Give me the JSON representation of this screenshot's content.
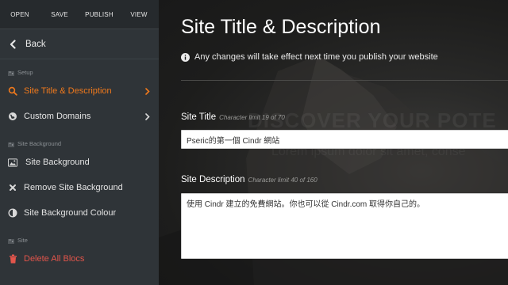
{
  "toolbar": {
    "open": "OPEN",
    "save": "SAVE",
    "publish": "PUBLISH",
    "view": "VIEW"
  },
  "sidebar": {
    "back_label": "Back",
    "sections": [
      {
        "title": "Setup",
        "items": [
          {
            "label": "Site Title & Description",
            "icon": "search-icon",
            "active": true
          },
          {
            "label": "Custom Domains",
            "icon": "globe-icon"
          }
        ]
      },
      {
        "title": "Site Background",
        "items": [
          {
            "label": "Site Background",
            "icon": "image-icon"
          },
          {
            "label": "Remove Site Background",
            "icon": "close-icon"
          },
          {
            "label": "Site Background Colour",
            "icon": "contrast-icon"
          }
        ]
      },
      {
        "title": "Site",
        "items": [
          {
            "label": "Delete All Blocs",
            "icon": "trash-icon"
          }
        ]
      }
    ]
  },
  "main": {
    "title": "Site Title & Description",
    "notice": "Any changes will take effect next time you publish your website",
    "background_headline": "DISCOVER YOUR POTE",
    "background_sub": "Lorem ipsum dolor sit amet, conse",
    "fields": {
      "site_title": {
        "label": "Site Title",
        "limit": "Character limit 19 of 70",
        "value": "Pseric的第一個 Cindr 網站"
      },
      "site_description": {
        "label": "Site Description",
        "limit": "Character limit 40 of 160",
        "value": "使用 Cindr 建立的免費網站。你也可以從 Cindr.com 取得你自己的。"
      }
    }
  },
  "colors": {
    "accent": "#f0791c",
    "danger": "#e2554b",
    "sidebar_bg": "#2f3438",
    "topbar_bg": "#262a2d"
  }
}
